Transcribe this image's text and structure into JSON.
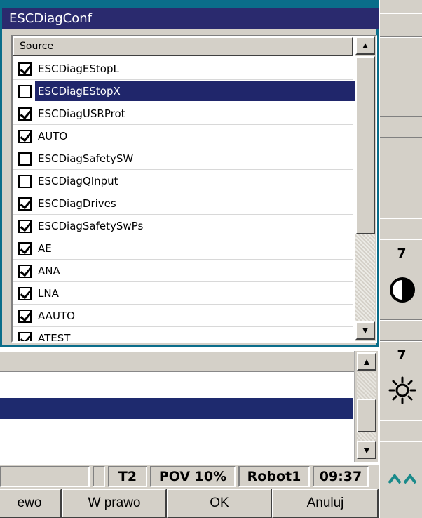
{
  "popup": {
    "title": "ESCDiagConf",
    "column_header": "Source",
    "scroll_up": "▲",
    "scroll_down": "▼",
    "rows": [
      {
        "label": "ESCDiagEStopL",
        "checked": true,
        "selected": false
      },
      {
        "label": "ESCDiagEStopX",
        "checked": false,
        "selected": true
      },
      {
        "label": "ESCDiagUSRProt",
        "checked": true,
        "selected": false
      },
      {
        "label": "AUTO",
        "checked": true,
        "selected": false
      },
      {
        "label": "ESCDiagSafetySW",
        "checked": false,
        "selected": false
      },
      {
        "label": "ESCDiagQInput",
        "checked": false,
        "selected": false
      },
      {
        "label": "ESCDiagDrives",
        "checked": true,
        "selected": false
      },
      {
        "label": "ESCDiagSafetySwPs",
        "checked": true,
        "selected": false
      },
      {
        "label": "AE",
        "checked": true,
        "selected": false
      },
      {
        "label": "ANA",
        "checked": true,
        "selected": false
      },
      {
        "label": "LNA",
        "checked": true,
        "selected": false
      },
      {
        "label": "AAUTO",
        "checked": true,
        "selected": false
      },
      {
        "label": "ATEST",
        "checked": true,
        "selected": false
      }
    ]
  },
  "background_list": {
    "scroll_up": "▲",
    "scroll_down": "▼"
  },
  "status_bar": {
    "tool": "T2",
    "pov": "POV 10%",
    "robot": "Robot1",
    "time": "09:37"
  },
  "buttons": {
    "left": "ewo",
    "right": "W prawo",
    "ok": "OK",
    "cancel": "Anuluj"
  },
  "right_panel": {
    "contrast_value": "7",
    "contrast_icon": "contrast-icon",
    "brightness_value": "7",
    "brightness_icon": "brightness-icon",
    "expand_icon": "double-chevron-up-icon"
  },
  "colors": {
    "title_bar": "#2a2a6e",
    "selection": "#20266b",
    "window_frame": "#0a6d8a",
    "chevron": "#1a8a8a"
  }
}
